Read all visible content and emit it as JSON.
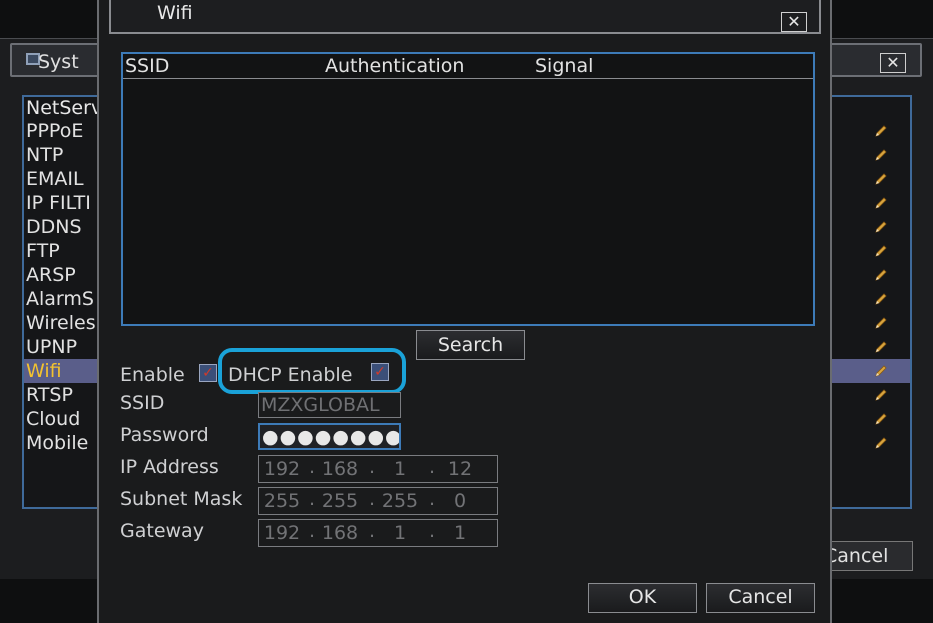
{
  "background_window": {
    "title": "Syst",
    "list_header": "NetServ",
    "items": [
      "PPPoE",
      "NTP",
      "EMAIL",
      "IP FILTI",
      "DDNS",
      "FTP",
      "ARSP",
      "AlarmS",
      "Wireles",
      "UPNP",
      "Wifi",
      "RTSP",
      "Cloud",
      "Mobile"
    ],
    "selected_item": "Wifi",
    "cancel_label": "Cancel"
  },
  "dialog": {
    "title": "Wifi",
    "columns": [
      "SSID",
      "Authentication",
      "Signal"
    ],
    "search_label": "Search",
    "enable_label": "Enable",
    "enable_checked": true,
    "dhcp_label": "DHCP Enable",
    "dhcp_checked": true,
    "ssid_label": "SSID",
    "ssid_value": "MZXGLOBAL",
    "password_label": "Password",
    "password_value": "●●●●●●●●●●●",
    "ip_label": "IP Address",
    "ip": [
      "192",
      "168",
      "1",
      "12"
    ],
    "mask_label": "Subnet Mask",
    "mask": [
      "255",
      "255",
      "255",
      "0"
    ],
    "gateway_label": "Gateway",
    "gateway": [
      "192",
      "168",
      "1",
      "1"
    ],
    "ok_label": "OK",
    "cancel_label": "Cancel"
  },
  "colors": {
    "highlight": "#1aa2d8",
    "selection": "#5a5e8a",
    "selected_text": "#f2c230"
  }
}
